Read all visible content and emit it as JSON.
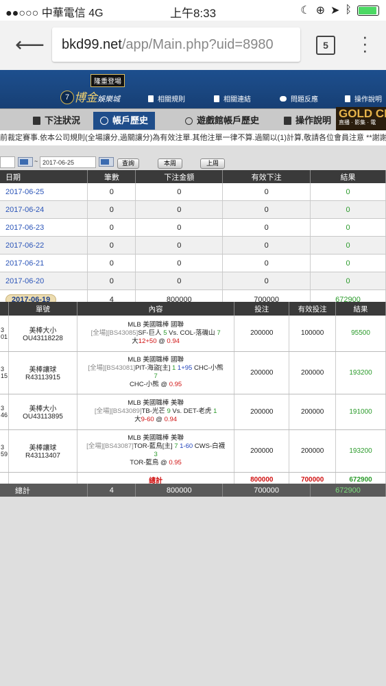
{
  "status_bar": {
    "carrier": "●●○○○ 中華電信  4G",
    "time": "上午8:33"
  },
  "browser": {
    "url_domain": "bkd99.net",
    "url_path": "/app/Main.php?uid=8980",
    "tab_count": "5"
  },
  "site": {
    "badge": "隆重登場",
    "logo_num": "7",
    "logo_name": "博金",
    "logo_sub": "娛樂城",
    "links": [
      "相關規則",
      "相關連結",
      "問題反應",
      "操作說明"
    ]
  },
  "nav": {
    "tabs": [
      "下注狀況",
      "帳戶歷史",
      "遊戲館帳戶歷史",
      "操作說明"
    ],
    "gold": "GOLD CL",
    "gold_sub": "直播 · 影集 · 電"
  },
  "notice": "前裁定賽事.依本公司規則(全場讓分,過關讓分)為有效注單.其他注單一律不算.過關以(1)計算,敬請各位會員注意 **謝謝**",
  "search": {
    "end_date": "2017-06-25",
    "query": "查詢",
    "this_week": "本周",
    "last_week": "上周"
  },
  "summary": {
    "headers": [
      "日期",
      "筆數",
      "下注金額",
      "有效下注",
      "結果"
    ],
    "rows": [
      [
        "2017-06-25",
        "0",
        "0",
        "0",
        "0"
      ],
      [
        "2017-06-24",
        "0",
        "0",
        "0",
        "0"
      ],
      [
        "2017-06-23",
        "0",
        "0",
        "0",
        "0"
      ],
      [
        "2017-06-22",
        "0",
        "0",
        "0",
        "0"
      ],
      [
        "2017-06-21",
        "0",
        "0",
        "0",
        "0"
      ],
      [
        "2017-06-20",
        "0",
        "0",
        "0",
        "0"
      ],
      [
        "2017-06-19",
        "4",
        "800000",
        "700000",
        "672900"
      ]
    ]
  },
  "detail": {
    "headers": [
      "單號",
      "內容",
      "投注",
      "有效投注",
      "結果"
    ],
    "rows": [
      {
        "edge1": "3",
        "edge2": "01",
        "type": "美棒大小",
        "id": "OU43118228",
        "league": "MLB 美國職棒 國聯",
        "line2a": "[全場][BS43085]",
        "line2b": "SF-巨人",
        "n1": "5",
        "line2c": " Vs. COL-落磯山 ",
        "n2": "7",
        "line3a": "大",
        "line3b": "12+50",
        "line3c": " @ ",
        "odds": "0.94",
        "bet": "200000",
        "valid": "100000",
        "result": "95500"
      },
      {
        "edge1": "3",
        "edge2": "15",
        "type": "美棒讓球",
        "id": "R43113915",
        "league": "MLB 美國職棒 國聯",
        "line2a": "[全場][BS43081]",
        "line2b": "PIT-海盜[主] ",
        "n1": "1",
        "line2c": " ",
        "hcp": "1+95",
        "line2d": " CHC-小熊",
        "n2": "7",
        "line3a": "CHC-小熊",
        "line3c": " @ ",
        "odds": "0.95",
        "bet": "200000",
        "valid": "200000",
        "result": "193200"
      },
      {
        "edge1": "3",
        "edge2": "46",
        "type": "美棒大小",
        "id": "OU43113895",
        "league": "MLB 美國職棒 美聯",
        "line2a": "[全場][BS43089]",
        "line2b": "TB-光芒 ",
        "n1": "9",
        "line2c": " Vs. DET-老虎 ",
        "n2": "1",
        "line3a": "大",
        "line3b": "9-60",
        "line3c": " @ ",
        "odds": "0.94",
        "bet": "200000",
        "valid": "200000",
        "result": "191000"
      },
      {
        "edge1": "3",
        "edge2": "59",
        "type": "美棒讓球",
        "id": "R43113407",
        "league": "MLB 美國職棒 美聯",
        "line2a": "[全場][BS43087]",
        "line2b": "TOR-藍鳥[主] ",
        "n1": "7",
        "line2c": " ",
        "hcp": "1-60",
        "line2d": " CWS-白襪",
        "n2": "3",
        "line3a": "TOR-藍鳥",
        "line3c": " @ ",
        "odds": "0.95",
        "bet": "200000",
        "valid": "200000",
        "result": "193200"
      }
    ],
    "total": {
      "label": "總計",
      "bet": "800000",
      "valid": "700000",
      "result": "672900"
    }
  },
  "footer": {
    "label": "總計",
    "count": "4",
    "bet": "800000",
    "valid": "700000",
    "result": "672900"
  }
}
